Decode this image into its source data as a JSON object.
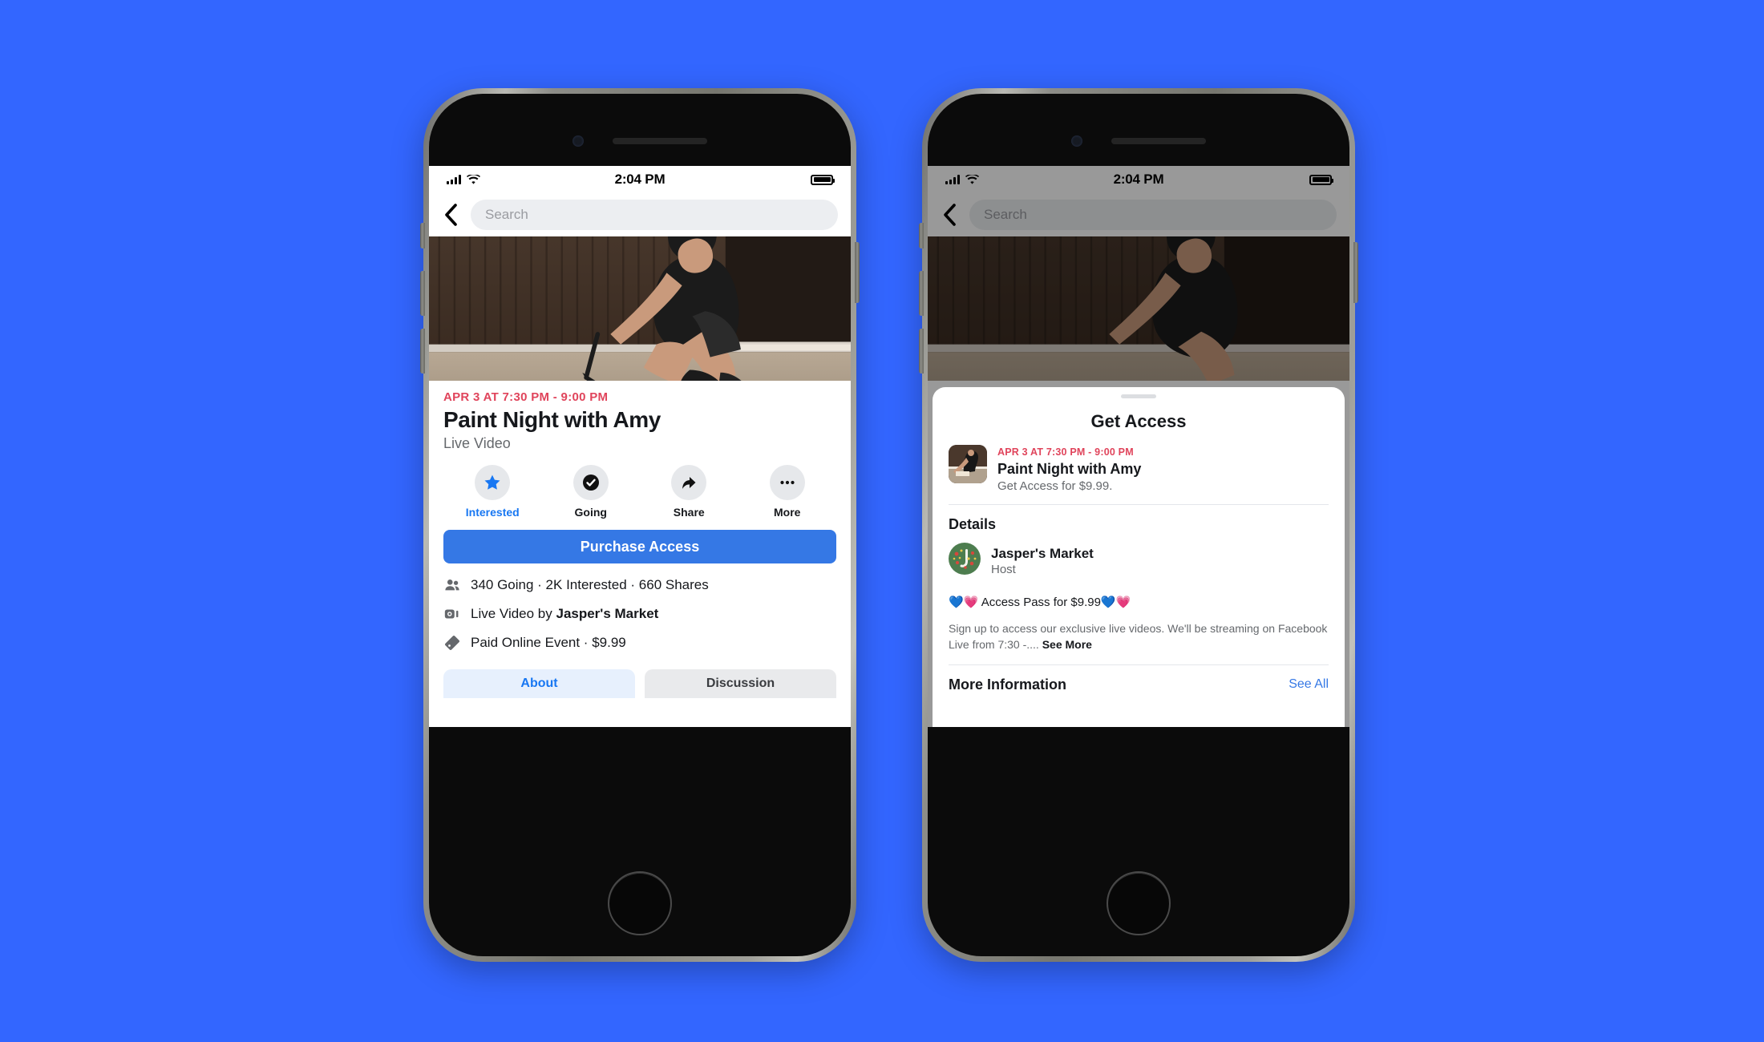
{
  "canvas": {
    "background_color": "#3366ff"
  },
  "statusbar": {
    "time": "2:04 PM",
    "signal_icon": "cellular-bars-icon",
    "wifi_icon": "wifi-icon",
    "battery_icon": "battery-full-icon"
  },
  "search": {
    "placeholder": "Search",
    "back_icon": "back-chevron-icon"
  },
  "left_phone": {
    "hero": {
      "alt": "woman crouching painting a canvas on the floor"
    },
    "event": {
      "date": "APR 3 AT 7:30 PM - 9:00 PM",
      "title": "Paint Night with Amy",
      "subtitle": "Live Video"
    },
    "actions": [
      {
        "label": "Interested",
        "icon": "star-icon",
        "active": true
      },
      {
        "label": "Going",
        "icon": "check-circle-icon",
        "active": false
      },
      {
        "label": "Share",
        "icon": "share-arrow-icon",
        "active": false
      },
      {
        "label": "More",
        "icon": "ellipsis-icon",
        "active": false
      }
    ],
    "primary_button": {
      "label": "Purchase Access",
      "color": "#3578e5"
    },
    "meta": [
      {
        "icon": "people-icon",
        "text": "340 Going · 2K Interested · 660 Shares",
        "bold": ""
      },
      {
        "icon": "live-video-icon",
        "text": "Live Video by ",
        "bold": "Jasper's Market"
      },
      {
        "icon": "ticket-icon",
        "text": "Paid Online Event · $9.99",
        "bold": ""
      }
    ],
    "tabs": [
      {
        "label": "About",
        "active": true
      },
      {
        "label": "Discussion",
        "active": false
      }
    ]
  },
  "right_phone": {
    "sheet": {
      "title": "Get Access",
      "grabber": "drag-handle",
      "event": {
        "date": "APR 3 AT 7:30 PM - 9:00 PM",
        "title": "Paint Night with Amy",
        "price_line": "Get Access for $9.99."
      },
      "details_heading": "Details",
      "host": {
        "name": "Jasper's Market",
        "role": "Host",
        "avatar_icon": "jaspers-market-logo"
      },
      "pass_line": "💙💗 Access Pass for $9.99💙💗",
      "description": "Sign up to access our exclusive live videos. We'll be streaming on Facebook Live from 7:30 -....",
      "see_more_label": "See More",
      "more_information_title": "More Information",
      "see_all_label": "See All"
    }
  }
}
